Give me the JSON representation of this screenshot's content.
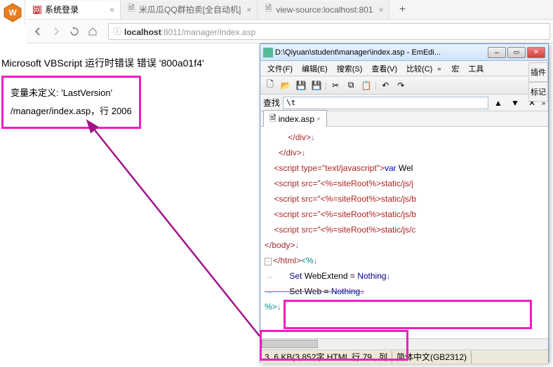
{
  "browser": {
    "tabs": [
      {
        "icon_color": "#c33",
        "label": "系统登录"
      },
      {
        "icon_color": "#999",
        "label": "米瓜瓜QQ群拍卖[全自动机]"
      },
      {
        "icon_color": "#999",
        "label": "view-source:localhost:801"
      }
    ],
    "url_host": "localhost",
    "url_port": ":8011",
    "url_path": "/manager/index.asp"
  },
  "error": {
    "heading": "Microsoft VBScript 运行时错误 错误 '800a01f4'",
    "line1": "变量未定义: 'LastVersion'",
    "line2": "/manager/index.asp，行 2006"
  },
  "editor": {
    "title": "D:\\Qiyuan\\student\\manager\\index.asp - EmEdi...",
    "menus": [
      "文件(F)",
      "编辑(E)",
      "搜索(S)",
      "查看(V)",
      "比较(C)",
      "宏",
      "工具"
    ],
    "side": [
      "插件",
      "标记"
    ],
    "search_label": "查找",
    "search_value": "\\t",
    "tab_name": "index.asp",
    "status_left": "3. 6 KB(3,852字 HTML 行 79 , 列",
    "status_right": "简体中文(GB2312)"
  },
  "code": {
    "l1": "    </div>",
    "l2": "  </div>",
    "l3a": "  <script type=",
    "l3b": "\"text/javascript\"",
    "l3c": ">",
    "l3d": "var",
    "l3e": " Wel",
    "l4a": "  <script src=",
    "l4b": "\"<%=siteRoot%>static/js/j",
    "l5a": "  <script src=",
    "l5b": "\"<%=siteRoot%>static/js/b",
    "l6a": "  <script src=",
    "l6b": "\"<%=siteRoot%>static/js/b",
    "l7a": "  <script src=",
    "l7b": "\"<%=siteRoot%>static/js/c",
    "l8": "</body>",
    "l9a": "</html>",
    "l9b": "<%",
    "l10a": "    Set ",
    "l10b": "WebExtend = ",
    "l10c": "Nothing",
    "l11a": "    Set Web = ",
    "l11b": "Nothing",
    "l12": "%>"
  }
}
